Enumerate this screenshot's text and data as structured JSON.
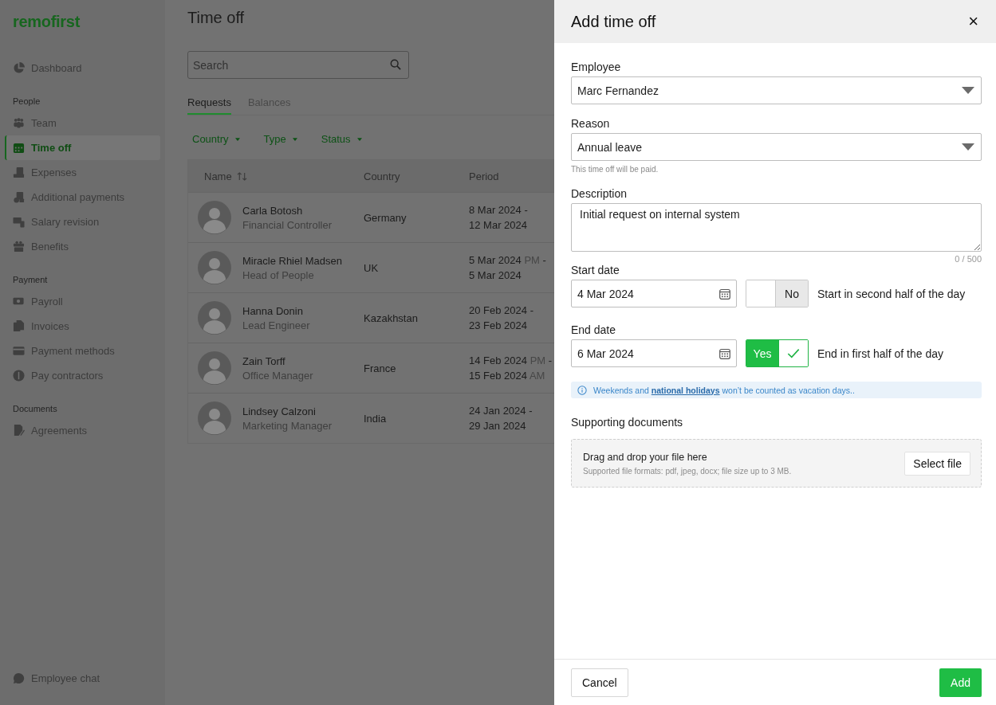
{
  "sidebar": {
    "logo": "remofirst",
    "sections": [
      {
        "items": [
          {
            "label": "Dashboard",
            "selected": false
          }
        ]
      },
      {
        "heading": "People",
        "items": [
          {
            "label": "Team",
            "selected": false
          },
          {
            "label": "Time off",
            "selected": true
          },
          {
            "label": "Expenses",
            "selected": false
          },
          {
            "label": "Additional payments",
            "selected": false
          },
          {
            "label": "Salary revision",
            "selected": false
          },
          {
            "label": "Benefits",
            "selected": false
          }
        ]
      },
      {
        "heading": "Payment",
        "items": [
          {
            "label": "Payroll",
            "selected": false
          },
          {
            "label": "Invoices",
            "selected": false
          },
          {
            "label": "Payment methods",
            "selected": false
          },
          {
            "label": "Pay contractors",
            "selected": false
          }
        ]
      },
      {
        "heading": "Documents",
        "items": [
          {
            "label": "Agreements",
            "selected": false
          }
        ]
      }
    ],
    "footer_item": "Employee chat"
  },
  "page": {
    "title": "Time off",
    "search": {
      "placeholder": "Search"
    },
    "tabs": [
      {
        "label": "Requests",
        "selected": true
      },
      {
        "label": "Balances",
        "selected": false
      }
    ],
    "filters": [
      "Country",
      "Type",
      "Status"
    ],
    "table": {
      "columns": [
        "Name",
        "Country",
        "Period"
      ],
      "rows": [
        {
          "name": "Carla Botosh",
          "role": "Financial Controller",
          "country": "Germany",
          "period": [
            [
              {
                "text": "8 Mar 2024",
                "muted": false
              },
              {
                "text": "-",
                "muted": false
              }
            ],
            [
              {
                "text": "12 Mar 2024",
                "muted": false
              }
            ]
          ]
        },
        {
          "name": "Miracle Rhiel Madsen",
          "role": "Head of People",
          "country": "UK",
          "period": [
            [
              {
                "text": "5 Mar 2024",
                "muted": false
              },
              {
                "text": "PM",
                "muted": true
              },
              {
                "text": "-",
                "muted": false
              }
            ],
            [
              {
                "text": "5 Mar 2024",
                "muted": false
              }
            ]
          ]
        },
        {
          "name": "Hanna Donin",
          "role": "Lead Engineer",
          "country": "Kazakhstan",
          "period": [
            [
              {
                "text": "20 Feb 2024",
                "muted": false
              },
              {
                "text": "-",
                "muted": false
              }
            ],
            [
              {
                "text": "23 Feb 2024",
                "muted": false
              }
            ]
          ]
        },
        {
          "name": "Zain Torff",
          "role": "Office Manager",
          "country": "France",
          "period": [
            [
              {
                "text": "14 Feb 2024",
                "muted": false
              },
              {
                "text": "PM",
                "muted": true
              },
              {
                "text": "-",
                "muted": false
              }
            ],
            [
              {
                "text": "15 Feb 2024",
                "muted": false
              },
              {
                "text": "AM",
                "muted": true
              }
            ]
          ]
        },
        {
          "name": "Lindsey Calzoni",
          "role": "Marketing Manager",
          "country": "India",
          "period": [
            [
              {
                "text": "24 Jan 2024",
                "muted": false
              },
              {
                "text": "-",
                "muted": false
              }
            ],
            [
              {
                "text": "29 Jan 2024",
                "muted": false
              }
            ]
          ]
        }
      ]
    }
  },
  "dialog": {
    "title": "Add time off",
    "close": "×",
    "employee": {
      "label": "Employee",
      "value": "Marc Fernandez"
    },
    "reason": {
      "label": "Reason",
      "value": "Annual leave",
      "hint": "This time off will be paid."
    },
    "description": {
      "label": "Description",
      "value": "Initial request on internal system",
      "counter": "0 / 500"
    },
    "start_date": {
      "label": "Start date",
      "value": "4 Mar 2024",
      "toggle": {
        "label": "No",
        "on": false
      },
      "toggle_text": "Start in second half of the day"
    },
    "end_date": {
      "label": "End date",
      "value": "6 Mar 2024",
      "toggle": {
        "label": "Yes",
        "on": true
      },
      "toggle_text": "End in first half of the day"
    },
    "notice": {
      "before": "Weekends and",
      "link": "national holidays",
      "after": "won’t be counted as vacation days.."
    },
    "documents": {
      "label": "Supporting documents",
      "title": "Drag and drop your file here",
      "hint": "Supported file formats: pdf, jpeg, docx; file size up to 3 MB.",
      "button": "Select file"
    },
    "buttons": {
      "cancel": "Cancel",
      "submit": "Add"
    }
  }
}
